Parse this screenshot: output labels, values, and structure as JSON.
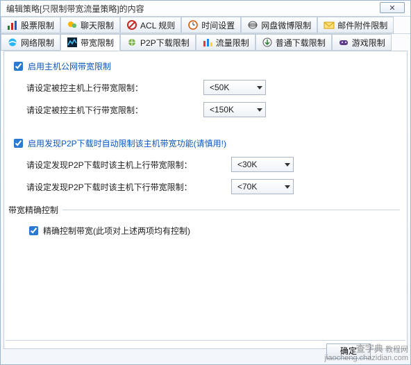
{
  "window": {
    "title": "编辑策略[只限制带宽流量策略]的内容",
    "close": "✕"
  },
  "tabs": {
    "row1": [
      {
        "label": "股票限制"
      },
      {
        "label": "聊天限制"
      },
      {
        "label": "ACL 规则"
      },
      {
        "label": "时间设置"
      },
      {
        "label": "网盘微博限制"
      },
      {
        "label": "邮件附件限制"
      }
    ],
    "row2": [
      {
        "label": "网络限制"
      },
      {
        "label": "带宽限制"
      },
      {
        "label": "P2P下载限制"
      },
      {
        "label": "流量限制"
      },
      {
        "label": "普通下载限制"
      },
      {
        "label": "游戏限制"
      }
    ],
    "active": "带宽限制"
  },
  "panel": {
    "section1": {
      "enable_label": "启用主机公网带宽限制",
      "enable_checked": true,
      "up_label": "请设定被控主机上行带宽限制：",
      "up_value": "<50K",
      "down_label": "请设定被控主机下行带宽限制：",
      "down_value": "<150K"
    },
    "section2": {
      "enable_label": "启用发现P2P下载时自动限制该主机带宽功能(请慎用!)",
      "enable_checked": true,
      "up_label": "请设定发现P2P下载时该主机上行带宽限制：",
      "up_value": "<30K",
      "down_label": "请设定发现P2P下载时该主机下行带宽限制：",
      "down_value": "<70K"
    },
    "section3": {
      "legend": "带宽精确控制",
      "enable_label": "精确控制带宽(此项对上述两项均有控制)",
      "enable_checked": true
    }
  },
  "buttons": {
    "ok": "确定"
  },
  "watermark": {
    "line1": "查字典",
    "line2": "教程网",
    "line3": "jiaocheng.chazidian.com"
  }
}
